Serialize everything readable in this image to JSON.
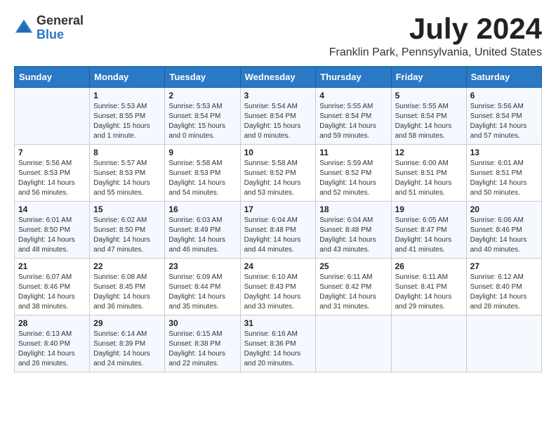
{
  "logo": {
    "general": "General",
    "blue": "Blue"
  },
  "title": "July 2024",
  "location": "Franklin Park, Pennsylvania, United States",
  "days_header": [
    "Sunday",
    "Monday",
    "Tuesday",
    "Wednesday",
    "Thursday",
    "Friday",
    "Saturday"
  ],
  "weeks": [
    [
      {
        "day": "",
        "sunrise": "",
        "sunset": "",
        "daylight": ""
      },
      {
        "day": "1",
        "sunrise": "Sunrise: 5:53 AM",
        "sunset": "Sunset: 8:55 PM",
        "daylight": "Daylight: 15 hours and 1 minute."
      },
      {
        "day": "2",
        "sunrise": "Sunrise: 5:53 AM",
        "sunset": "Sunset: 8:54 PM",
        "daylight": "Daylight: 15 hours and 0 minutes."
      },
      {
        "day": "3",
        "sunrise": "Sunrise: 5:54 AM",
        "sunset": "Sunset: 8:54 PM",
        "daylight": "Daylight: 15 hours and 0 minutes."
      },
      {
        "day": "4",
        "sunrise": "Sunrise: 5:55 AM",
        "sunset": "Sunset: 8:54 PM",
        "daylight": "Daylight: 14 hours and 59 minutes."
      },
      {
        "day": "5",
        "sunrise": "Sunrise: 5:55 AM",
        "sunset": "Sunset: 8:54 PM",
        "daylight": "Daylight: 14 hours and 58 minutes."
      },
      {
        "day": "6",
        "sunrise": "Sunrise: 5:56 AM",
        "sunset": "Sunset: 8:54 PM",
        "daylight": "Daylight: 14 hours and 57 minutes."
      }
    ],
    [
      {
        "day": "7",
        "sunrise": "Sunrise: 5:56 AM",
        "sunset": "Sunset: 8:53 PM",
        "daylight": "Daylight: 14 hours and 56 minutes."
      },
      {
        "day": "8",
        "sunrise": "Sunrise: 5:57 AM",
        "sunset": "Sunset: 8:53 PM",
        "daylight": "Daylight: 14 hours and 55 minutes."
      },
      {
        "day": "9",
        "sunrise": "Sunrise: 5:58 AM",
        "sunset": "Sunset: 8:53 PM",
        "daylight": "Daylight: 14 hours and 54 minutes."
      },
      {
        "day": "10",
        "sunrise": "Sunrise: 5:58 AM",
        "sunset": "Sunset: 8:52 PM",
        "daylight": "Daylight: 14 hours and 53 minutes."
      },
      {
        "day": "11",
        "sunrise": "Sunrise: 5:59 AM",
        "sunset": "Sunset: 8:52 PM",
        "daylight": "Daylight: 14 hours and 52 minutes."
      },
      {
        "day": "12",
        "sunrise": "Sunrise: 6:00 AM",
        "sunset": "Sunset: 8:51 PM",
        "daylight": "Daylight: 14 hours and 51 minutes."
      },
      {
        "day": "13",
        "sunrise": "Sunrise: 6:01 AM",
        "sunset": "Sunset: 8:51 PM",
        "daylight": "Daylight: 14 hours and 50 minutes."
      }
    ],
    [
      {
        "day": "14",
        "sunrise": "Sunrise: 6:01 AM",
        "sunset": "Sunset: 8:50 PM",
        "daylight": "Daylight: 14 hours and 48 minutes."
      },
      {
        "day": "15",
        "sunrise": "Sunrise: 6:02 AM",
        "sunset": "Sunset: 8:50 PM",
        "daylight": "Daylight: 14 hours and 47 minutes."
      },
      {
        "day": "16",
        "sunrise": "Sunrise: 6:03 AM",
        "sunset": "Sunset: 8:49 PM",
        "daylight": "Daylight: 14 hours and 46 minutes."
      },
      {
        "day": "17",
        "sunrise": "Sunrise: 6:04 AM",
        "sunset": "Sunset: 8:48 PM",
        "daylight": "Daylight: 14 hours and 44 minutes."
      },
      {
        "day": "18",
        "sunrise": "Sunrise: 6:04 AM",
        "sunset": "Sunset: 8:48 PM",
        "daylight": "Daylight: 14 hours and 43 minutes."
      },
      {
        "day": "19",
        "sunrise": "Sunrise: 6:05 AM",
        "sunset": "Sunset: 8:47 PM",
        "daylight": "Daylight: 14 hours and 41 minutes."
      },
      {
        "day": "20",
        "sunrise": "Sunrise: 6:06 AM",
        "sunset": "Sunset: 8:46 PM",
        "daylight": "Daylight: 14 hours and 40 minutes."
      }
    ],
    [
      {
        "day": "21",
        "sunrise": "Sunrise: 6:07 AM",
        "sunset": "Sunset: 8:46 PM",
        "daylight": "Daylight: 14 hours and 38 minutes."
      },
      {
        "day": "22",
        "sunrise": "Sunrise: 6:08 AM",
        "sunset": "Sunset: 8:45 PM",
        "daylight": "Daylight: 14 hours and 36 minutes."
      },
      {
        "day": "23",
        "sunrise": "Sunrise: 6:09 AM",
        "sunset": "Sunset: 8:44 PM",
        "daylight": "Daylight: 14 hours and 35 minutes."
      },
      {
        "day": "24",
        "sunrise": "Sunrise: 6:10 AM",
        "sunset": "Sunset: 8:43 PM",
        "daylight": "Daylight: 14 hours and 33 minutes."
      },
      {
        "day": "25",
        "sunrise": "Sunrise: 6:11 AM",
        "sunset": "Sunset: 8:42 PM",
        "daylight": "Daylight: 14 hours and 31 minutes."
      },
      {
        "day": "26",
        "sunrise": "Sunrise: 6:11 AM",
        "sunset": "Sunset: 8:41 PM",
        "daylight": "Daylight: 14 hours and 29 minutes."
      },
      {
        "day": "27",
        "sunrise": "Sunrise: 6:12 AM",
        "sunset": "Sunset: 8:40 PM",
        "daylight": "Daylight: 14 hours and 28 minutes."
      }
    ],
    [
      {
        "day": "28",
        "sunrise": "Sunrise: 6:13 AM",
        "sunset": "Sunset: 8:40 PM",
        "daylight": "Daylight: 14 hours and 26 minutes."
      },
      {
        "day": "29",
        "sunrise": "Sunrise: 6:14 AM",
        "sunset": "Sunset: 8:39 PM",
        "daylight": "Daylight: 14 hours and 24 minutes."
      },
      {
        "day": "30",
        "sunrise": "Sunrise: 6:15 AM",
        "sunset": "Sunset: 8:38 PM",
        "daylight": "Daylight: 14 hours and 22 minutes."
      },
      {
        "day": "31",
        "sunrise": "Sunrise: 6:16 AM",
        "sunset": "Sunset: 8:36 PM",
        "daylight": "Daylight: 14 hours and 20 minutes."
      },
      {
        "day": "",
        "sunrise": "",
        "sunset": "",
        "daylight": ""
      },
      {
        "day": "",
        "sunrise": "",
        "sunset": "",
        "daylight": ""
      },
      {
        "day": "",
        "sunrise": "",
        "sunset": "",
        "daylight": ""
      }
    ]
  ]
}
